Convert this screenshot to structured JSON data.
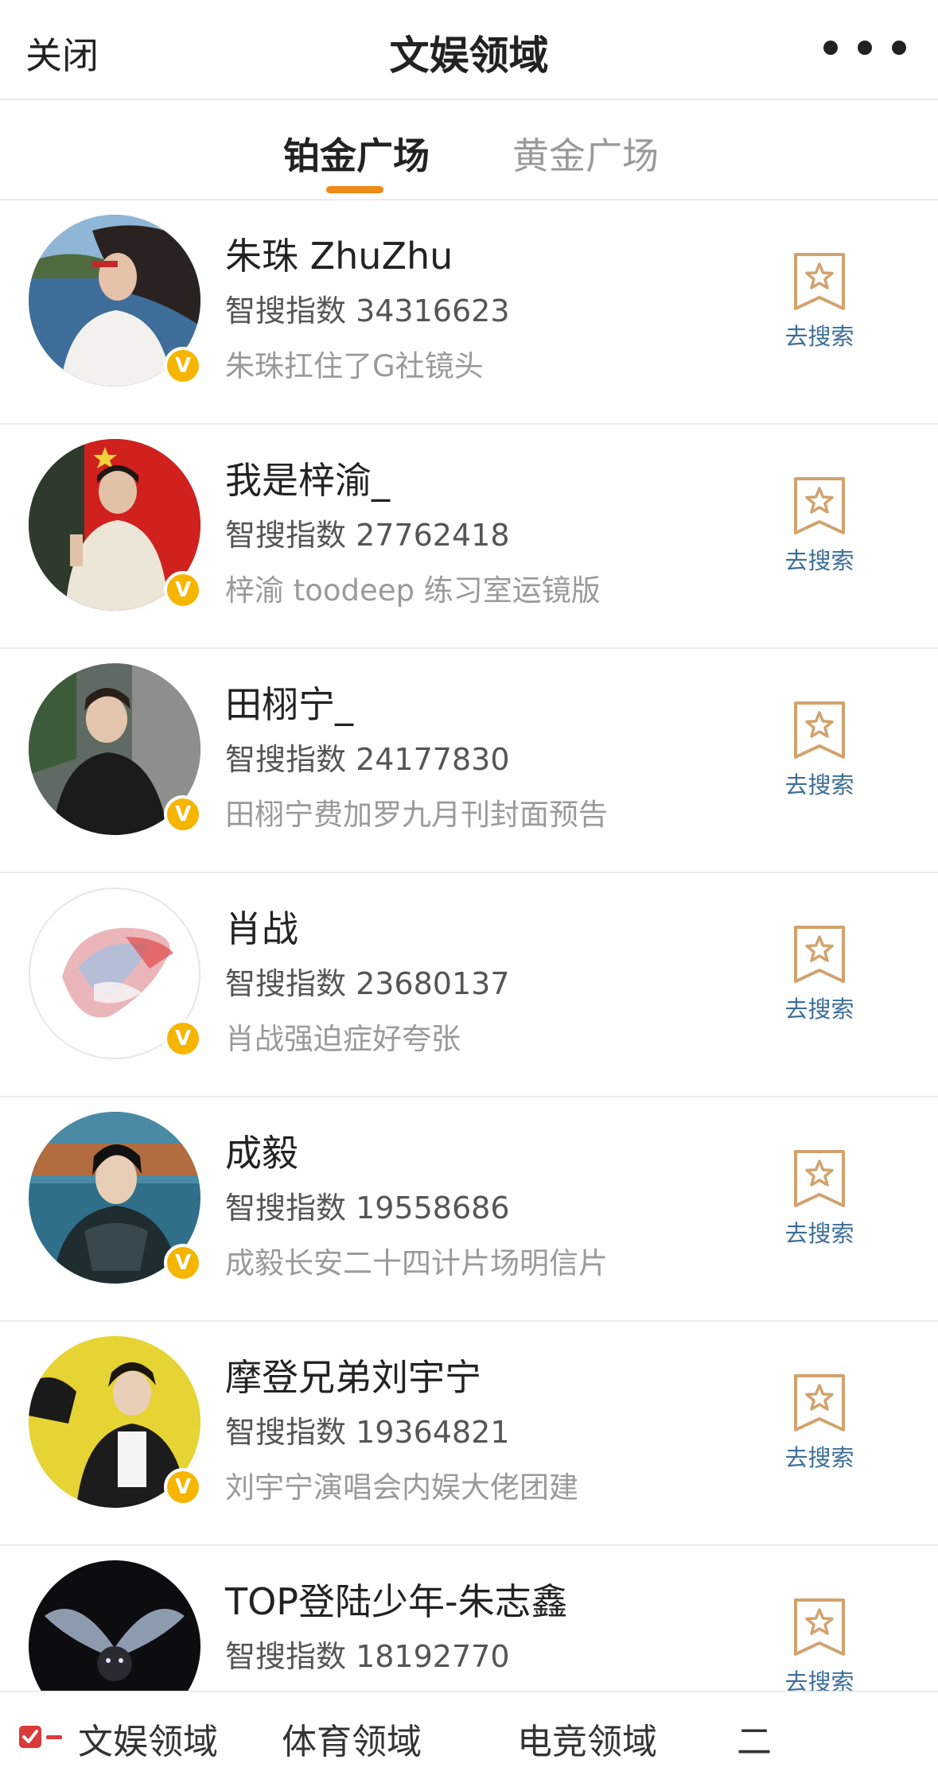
{
  "header": {
    "close_label": "关闭",
    "title": "文娱领域",
    "more_icon": "more-horizontal-icon"
  },
  "tabs": [
    {
      "label": "铂金广场",
      "active": true
    },
    {
      "label": "黄金广场",
      "active": false
    }
  ],
  "accent_color": "#f08a16",
  "badge_color": "#f6b500",
  "link_color": "#3c6e99",
  "verified_badge_icon": "verified-v-icon",
  "search_icon": "star-bookmark-icon",
  "items": [
    {
      "name": "朱珠 ZhuZhu",
      "index_label": "智搜指数 34316623",
      "description": "朱珠扛住了G社镜头",
      "action_label": "去搜索"
    },
    {
      "name": "我是梓渝_",
      "index_label": "智搜指数 27762418",
      "description": "梓渝 toodeep 练习室运镜版",
      "action_label": "去搜索"
    },
    {
      "name": "田栩宁_",
      "index_label": "智搜指数 24177830",
      "description": "田栩宁费加罗九月刊封面预告",
      "action_label": "去搜索"
    },
    {
      "name": "肖战",
      "index_label": "智搜指数 23680137",
      "description": "肖战强迫症好夸张",
      "action_label": "去搜索"
    },
    {
      "name": "成毅",
      "index_label": "智搜指数 19558686",
      "description": "成毅长安二十四计片场明信片",
      "action_label": "去搜索"
    },
    {
      "name": "摩登兄弟刘宇宁",
      "index_label": "智搜指数 19364821",
      "description": "刘宇宁演唱会内娱大佬团建",
      "action_label": "去搜索"
    },
    {
      "name": "TOP登陆少年-朱志鑫",
      "index_label": "智搜指数 18192770",
      "description": "",
      "action_label": "去搜索"
    }
  ],
  "bottom_nav": {
    "icon": "checkbox-list-icon",
    "items": [
      "文娱领域",
      "体育领域",
      "电竞领域",
      "二"
    ]
  }
}
